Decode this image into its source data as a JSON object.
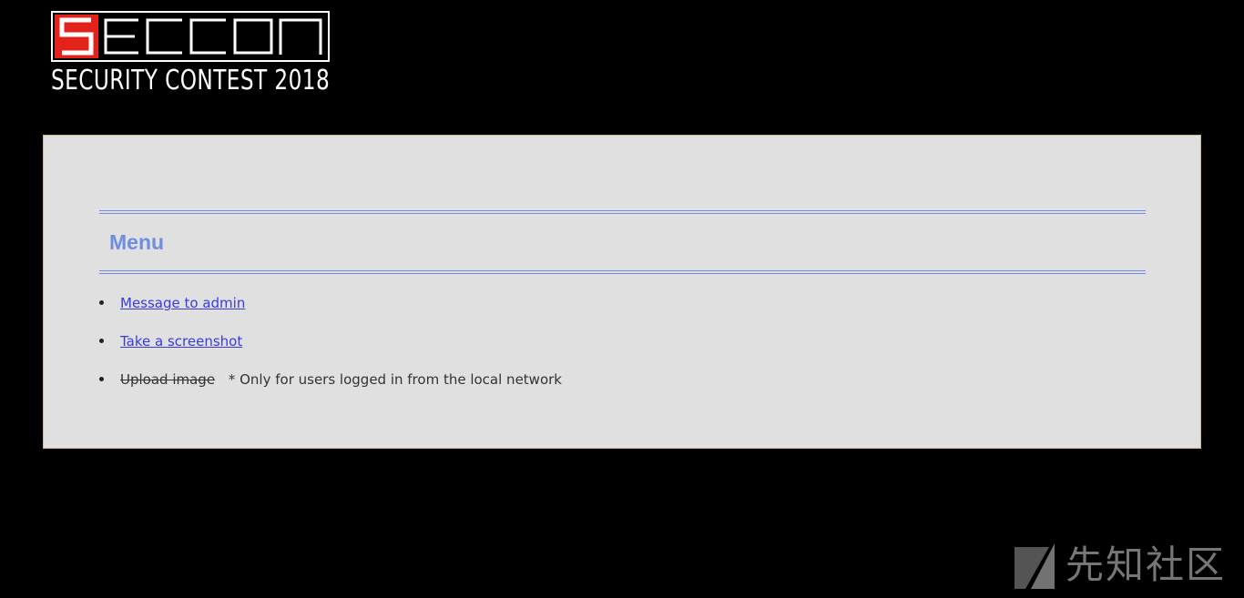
{
  "logo": {
    "brand": "SECCON",
    "tagline": "SECURITY CONTEST 2018"
  },
  "panel": {
    "title": "Menu",
    "items": [
      {
        "label": "Message to admin",
        "state": "link"
      },
      {
        "label": "Take a screenshot",
        "state": "link"
      },
      {
        "label": "Upload image",
        "state": "disabled",
        "note": "* Only for users logged in from the local network"
      }
    ]
  },
  "watermark": {
    "text": "先知社区",
    "icon": "slash-logo-icon"
  },
  "colors": {
    "background": "#000000",
    "panel": "#e0e0e0",
    "panel_border": "#c8b98a",
    "accent": "#6f8ee0",
    "link": "#3a3adf",
    "logo_red": "#e3231b"
  }
}
